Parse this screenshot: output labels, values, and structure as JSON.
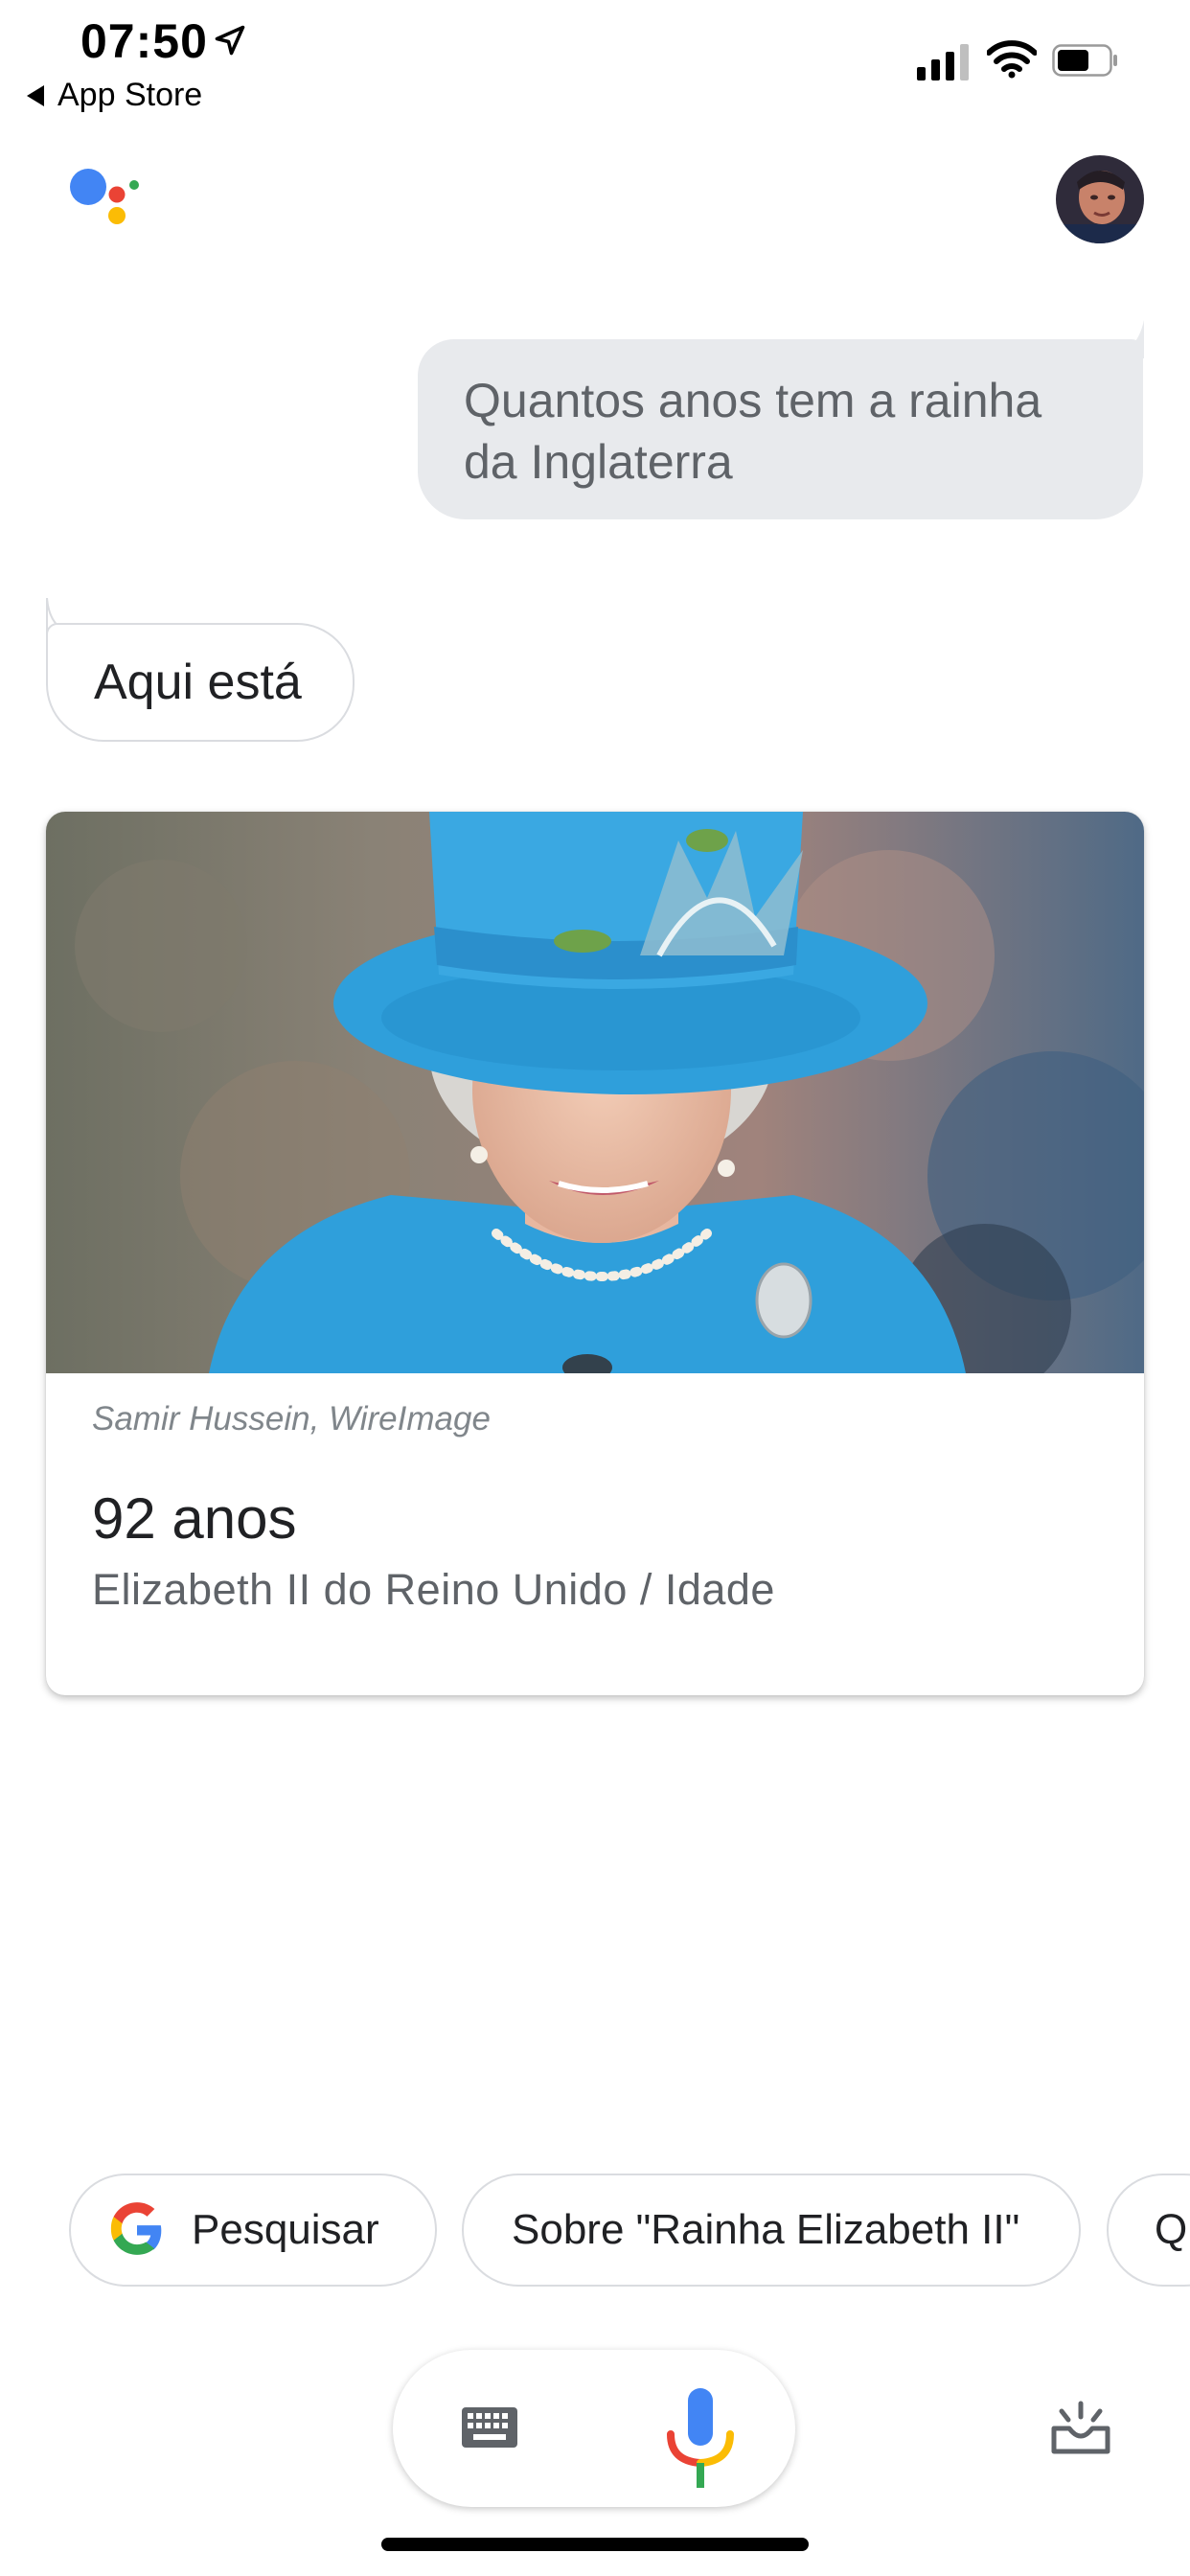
{
  "status_bar": {
    "time": "07:50",
    "back_label": "App Store"
  },
  "conversation": {
    "user_query": "Quantos anos tem a rainha da Inglaterra",
    "assistant_reply": "Aqui está"
  },
  "answer_card": {
    "image_credit": "Samir Hussein, WireImage",
    "answer": "92 anos",
    "subject": "Elizabeth II do Reino Unido / Idade"
  },
  "suggestions": [
    {
      "label": "Pesquisar"
    },
    {
      "label": "Sobre \"Rainha Elizabeth II\""
    },
    {
      "label": "Qu"
    }
  ],
  "colors": {
    "google_blue": "#4285F4",
    "google_red": "#EA4335",
    "google_yellow": "#FBBC05",
    "google_green": "#34A853",
    "hat_blue": "#3aa0d8"
  }
}
